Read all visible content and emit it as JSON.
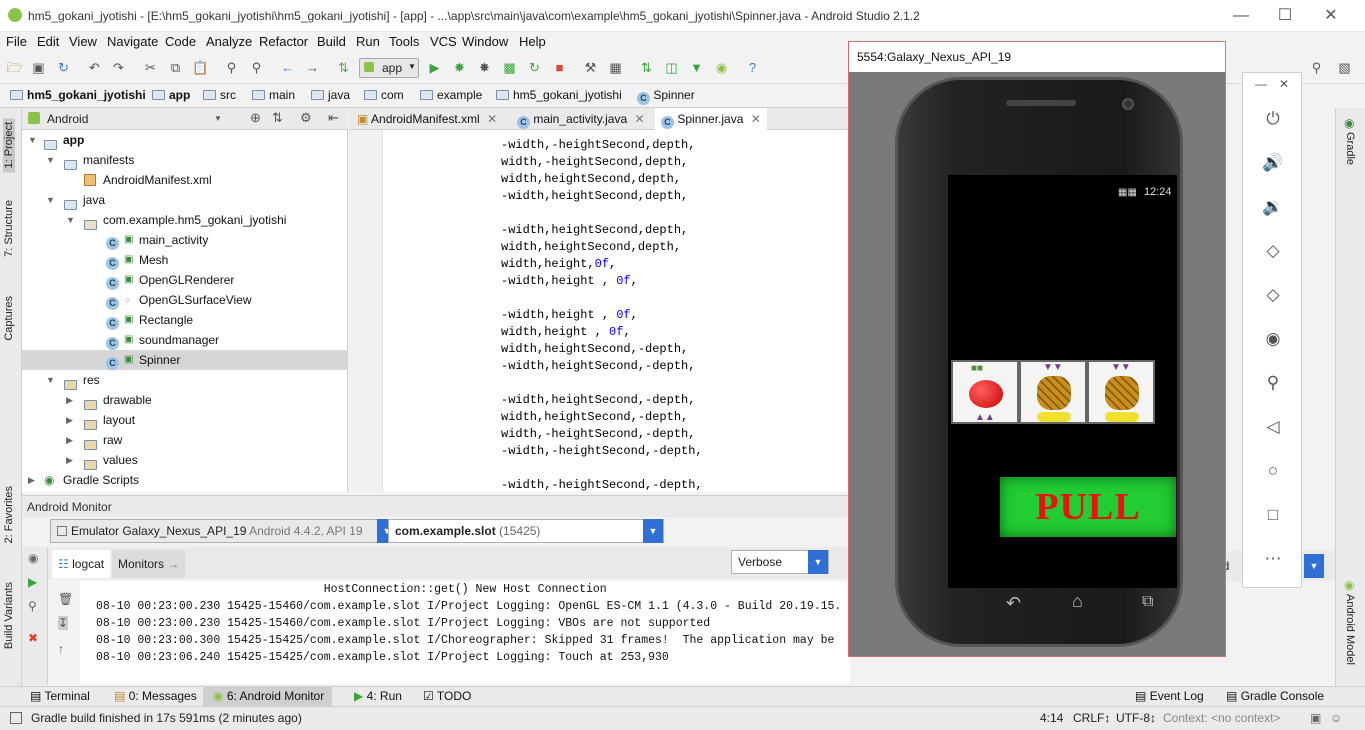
{
  "window": {
    "title": "hm5_gokani_jyotishi - [E:\\hm5_gokani_jyotishi\\hm5_gokani_jyotishi] - [app] - ...\\app\\src\\main\\java\\com\\example\\hm5_gokani_jyotishi\\Spinner.java - Android Studio 2.1.2"
  },
  "menu": [
    "File",
    "Edit",
    "View",
    "Navigate",
    "Code",
    "Analyze",
    "Refactor",
    "Build",
    "Run",
    "Tools",
    "VCS",
    "Window",
    "Help"
  ],
  "toolbar": {
    "run_config": "app"
  },
  "breadcrumb": [
    "hm5_gokani_jyotishi",
    "app",
    "src",
    "main",
    "java",
    "com",
    "example",
    "hm5_gokani_jyotishi",
    "Spinner"
  ],
  "left_tools": [
    "1: Project",
    "7: Structure",
    "Captures",
    "2: Favorites",
    "Build Variants"
  ],
  "project": {
    "view": "Android",
    "tree": [
      {
        "label": "app",
        "level": 0,
        "kind": "module"
      },
      {
        "label": "manifests",
        "level": 1,
        "kind": "folder"
      },
      {
        "label": "AndroidManifest.xml",
        "level": 2,
        "kind": "xml"
      },
      {
        "label": "java",
        "level": 1,
        "kind": "folder"
      },
      {
        "label": "com.example.hm5_gokani_jyotishi",
        "level": 2,
        "kind": "package"
      },
      {
        "label": "main_activity",
        "level": 3,
        "kind": "class"
      },
      {
        "label": "Mesh",
        "level": 3,
        "kind": "class"
      },
      {
        "label": "OpenGLRenderer",
        "level": 3,
        "kind": "class"
      },
      {
        "label": "OpenGLSurfaceView",
        "level": 3,
        "kind": "class"
      },
      {
        "label": "Rectangle",
        "level": 3,
        "kind": "class"
      },
      {
        "label": "soundmanager",
        "level": 3,
        "kind": "class"
      },
      {
        "label": "Spinner",
        "level": 3,
        "kind": "class",
        "selected": true
      },
      {
        "label": "res",
        "level": 1,
        "kind": "folder"
      },
      {
        "label": "drawable",
        "level": 2,
        "kind": "folder"
      },
      {
        "label": "layout",
        "level": 2,
        "kind": "folder"
      },
      {
        "label": "raw",
        "level": 2,
        "kind": "folder"
      },
      {
        "label": "values",
        "level": 2,
        "kind": "folder"
      },
      {
        "label": "Gradle Scripts",
        "level": 0,
        "kind": "gradle"
      }
    ]
  },
  "editor": {
    "tabs": [
      {
        "label": "AndroidManifest.xml",
        "active": false
      },
      {
        "label": "main_activity.java",
        "active": false
      },
      {
        "label": "Spinner.java",
        "active": true
      }
    ],
    "lines": [
      "-width,-heightSecond,depth,",
      "width,-heightSecond,depth,",
      "width,heightSecond,depth,",
      "-width,heightSecond,depth,",
      "",
      "-width,heightSecond,depth,",
      "width,heightSecond,depth,",
      "width,height,0f,",
      "-width,height , 0f,",
      "",
      "-width,height , 0f,",
      "width,height , 0f,",
      "width,heightSecond,-depth,",
      "-width,heightSecond,-depth,",
      "",
      "-width,heightSecond,-depth,",
      "width,heightSecond,-depth,",
      "width,-heightSecond,-depth,",
      "-width,-heightSecond,-depth,",
      "",
      "-width,-heightSecond,-depth,"
    ]
  },
  "monitor": {
    "title": "Android Monitor",
    "device_name": "Emulator Galaxy_Nexus_API_19",
    "device_info": "Android 4.4.2, API 19",
    "process_pkg": "com.example.slot",
    "process_pid": "(15425)",
    "tabs": [
      "logcat",
      "Monitors"
    ],
    "log_level": "Verbose",
    "filter_partial": "ed",
    "log": [
      "                                 HostConnection::get() New Host Connection",
      "08-10 00:23:00.230 15425-15460/com.example.slot I/Project Logging: OpenGL ES-CM 1.1 (4.3.0 - Build 20.19.15.",
      "08-10 00:23:00.230 15425-15460/com.example.slot I/Project Logging: VBOs are not supported",
      "08-10 00:23:00.300 15425-15425/com.example.slot I/Choreographer: Skipped 31 frames!  The application may be",
      "08-10 00:23:06.240 15425-15425/com.example.slot I/Project Logging: Touch at 253,930"
    ]
  },
  "bottom_tabs": {
    "left": [
      "Terminal",
      "0: Messages",
      "6: Android Monitor",
      "4: Run",
      "TODO"
    ],
    "right": [
      "Event Log",
      "Gradle Console"
    ]
  },
  "status": {
    "message": "Gradle build finished in 17s 591ms (2 minutes ago)",
    "position": "4:14",
    "line_sep": "CRLF↕",
    "encoding": "UTF-8↕",
    "context": "Context: <no context>"
  },
  "right_tools": [
    "Gradle",
    "Android Model"
  ],
  "emulator": {
    "title": "5554:Galaxy_Nexus_API_19",
    "clock": "12:24",
    "pull_label": "PULL",
    "reels": [
      "apple",
      "pineapple",
      "pineapple"
    ]
  },
  "colors": {
    "accent": "#2f6fd6",
    "pull_bg": "#22cc33",
    "pull_text": "#ee1111"
  }
}
